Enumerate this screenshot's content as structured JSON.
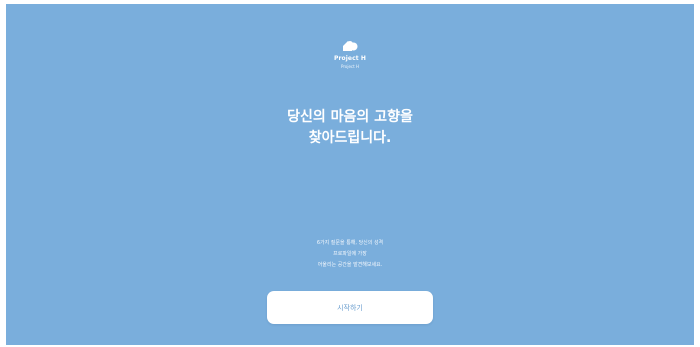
{
  "brand": {
    "name": "Project H",
    "subtitle": "Project H",
    "logo_icon": "house-cloud-icon"
  },
  "headline": {
    "line1": "당신의 마음의 고향을",
    "line2": "찾아드립니다."
  },
  "description": {
    "line1": "6가지 질문을 통해, 당신의 성격",
    "line2": "프로파일에 가장",
    "line3": "어울리는 공간을 발견해보세요."
  },
  "actions": {
    "start_label": "시작하기"
  },
  "colors": {
    "background": "#7aaedc",
    "button_bg": "#ffffff",
    "button_text": "#6d9fcf"
  }
}
